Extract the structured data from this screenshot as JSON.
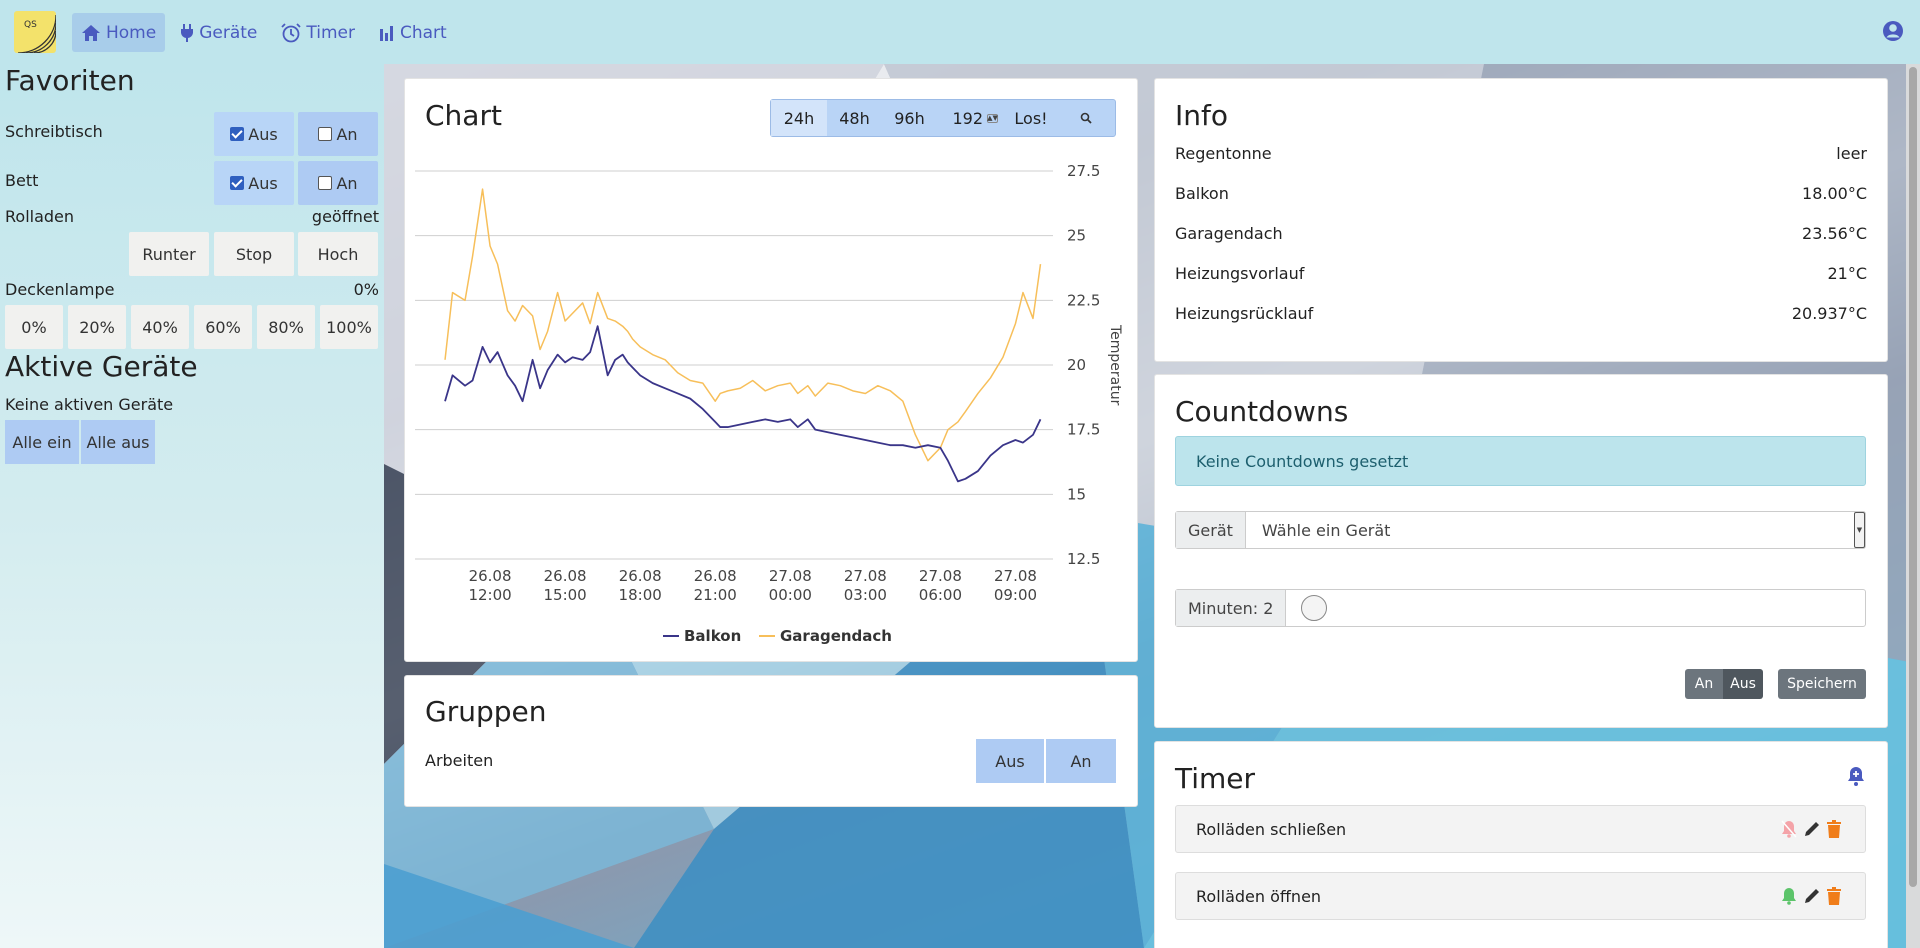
{
  "nav": {
    "logo_text": "QS",
    "items": [
      {
        "label": "Home",
        "icon": "home-icon",
        "active": true
      },
      {
        "label": "Geräte",
        "icon": "plug-icon"
      },
      {
        "label": "Timer",
        "icon": "alarm-clock-icon"
      },
      {
        "label": "Chart",
        "icon": "bar-chart-icon"
      }
    ],
    "user_icon": "user-circle-icon"
  },
  "sidebar": {
    "favorites_title": "Favoriten",
    "schreibtisch": {
      "label": "Schreibtisch",
      "off_label": "Aus",
      "on_label": "An"
    },
    "bett": {
      "label": "Bett",
      "off_label": "Aus",
      "on_label": "An"
    },
    "rolladen": {
      "label": "Rolladen",
      "status": "geöffnet",
      "down": "Runter",
      "stop": "Stop",
      "up": "Hoch"
    },
    "deckenlampe": {
      "label": "Deckenlampe",
      "value": "0%",
      "levels": [
        "0%",
        "20%",
        "40%",
        "60%",
        "80%",
        "100%"
      ]
    },
    "active_title": "Aktive Geräte",
    "no_active": "Keine aktiven Geräte",
    "all_on": "Alle ein",
    "all_off": "Alle aus"
  },
  "chart_card": {
    "title": "Chart",
    "ranges": [
      "24h",
      "48h",
      "96h"
    ],
    "custom_hours": "192",
    "go_label": "Los!",
    "zoom_icon": "magnifier-icon"
  },
  "chart_data": {
    "type": "line",
    "ylabel": "Temperatur",
    "ylim": [
      12.5,
      27.5
    ],
    "yticks": [
      "27.5",
      "25",
      "22.5",
      "20",
      "17.5",
      "15",
      "12.5"
    ],
    "xticks": [
      {
        "d": "26.08",
        "t": "12:00"
      },
      {
        "d": "26.08",
        "t": "15:00"
      },
      {
        "d": "26.08",
        "t": "18:00"
      },
      {
        "d": "26.08",
        "t": "21:00"
      },
      {
        "d": "27.08",
        "t": "00:00"
      },
      {
        "d": "27.08",
        "t": "03:00"
      },
      {
        "d": "27.08",
        "t": "06:00"
      },
      {
        "d": "27.08",
        "t": "09:00"
      }
    ],
    "x_hours": [
      10.2,
      10.5,
      11,
      11.3,
      11.7,
      12,
      12.3,
      12.7,
      13,
      13.3,
      13.7,
      14,
      14.3,
      14.7,
      15,
      15.3,
      15.7,
      16,
      16.3,
      16.7,
      17,
      17.3,
      17.5,
      17.7,
      18,
      18.5,
      19,
      19.5,
      20,
      20.5,
      21,
      21.2,
      21.5,
      22,
      22.5,
      23,
      23.5,
      24,
      24.3,
      24.7,
      25,
      25.5,
      26,
      26.5,
      27,
      27.5,
      28,
      28.5,
      29,
      29.5,
      30,
      30.3,
      30.7,
      31,
      31.5,
      32,
      32.5,
      33,
      33.3,
      33.7,
      34
    ],
    "series": [
      {
        "name": "Balkon",
        "color": "#3a3589",
        "values": [
          18.6,
          19.6,
          19.2,
          19.4,
          20.7,
          20.1,
          20.5,
          19.6,
          19.2,
          18.6,
          20.2,
          19.1,
          19.8,
          20.4,
          20.1,
          20.3,
          20.2,
          20.5,
          21.5,
          19.6,
          20.2,
          20.4,
          20.1,
          19.9,
          19.6,
          19.3,
          19.1,
          18.9,
          18.7,
          18.3,
          17.8,
          17.6,
          17.6,
          17.7,
          17.8,
          17.9,
          17.8,
          17.9,
          17.6,
          17.9,
          17.5,
          17.4,
          17.3,
          17.2,
          17.1,
          17.0,
          16.9,
          16.9,
          16.8,
          16.9,
          16.8,
          16.3,
          15.5,
          15.6,
          15.9,
          16.5,
          16.9,
          17.1,
          17.0,
          17.3,
          17.9
        ]
      },
      {
        "name": "Garagendach",
        "color": "#f7bf5a",
        "values": [
          20.2,
          22.8,
          22.5,
          24.2,
          26.8,
          24.6,
          23.9,
          22.1,
          21.7,
          22.3,
          21.9,
          20.6,
          21.3,
          22.8,
          21.7,
          22.0,
          22.4,
          21.6,
          22.8,
          21.8,
          21.7,
          21.5,
          21.3,
          21.0,
          20.7,
          20.4,
          20.2,
          19.7,
          19.4,
          19.3,
          18.6,
          18.9,
          19.0,
          19.1,
          19.4,
          19.0,
          19.2,
          19.3,
          18.9,
          19.2,
          18.8,
          19.3,
          19.2,
          19.0,
          18.9,
          19.2,
          19.0,
          18.6,
          17.3,
          16.3,
          16.8,
          17.5,
          17.8,
          18.2,
          18.9,
          19.5,
          20.3,
          21.6,
          22.8,
          21.8,
          23.9
        ]
      }
    ],
    "legend": [
      "Balkon",
      "Garagendach"
    ],
    "legend_position": "bottom"
  },
  "groups": {
    "title": "Gruppen",
    "name": "Arbeiten",
    "off_label": "Aus",
    "on_label": "An"
  },
  "info": {
    "title": "Info",
    "rows": [
      {
        "label": "Regentonne",
        "value": "leer"
      },
      {
        "label": "Balkon",
        "value": "18.00°C"
      },
      {
        "label": "Garagendach",
        "value": "23.56°C"
      },
      {
        "label": "Heizungsvorlauf",
        "value": "21°C"
      },
      {
        "label": "Heizungsrücklauf",
        "value": "20.937°C"
      }
    ]
  },
  "countdowns": {
    "title": "Countdowns",
    "empty_text": "Keine Countdowns gesetzt",
    "device_label": "Gerät",
    "device_placeholder": "Wähle ein Gerät",
    "minutes_label": "Minuten: 2",
    "on_label": "An",
    "off_label": "Aus",
    "save_label": "Speichern"
  },
  "timer": {
    "title": "Timer",
    "add_icon": "bell-plus-icon",
    "items": [
      {
        "label": "Rolläden schließen",
        "bell": "bell-off-icon",
        "bell_color": "#f4a3a8"
      },
      {
        "label": "Rolläden öffnen",
        "bell": "bell-icon",
        "bell_color": "#5cc46a"
      }
    ]
  },
  "colors": {
    "accent": "#4a5abf",
    "toggle": "#aecbf3",
    "trash": "#f07d1a"
  }
}
